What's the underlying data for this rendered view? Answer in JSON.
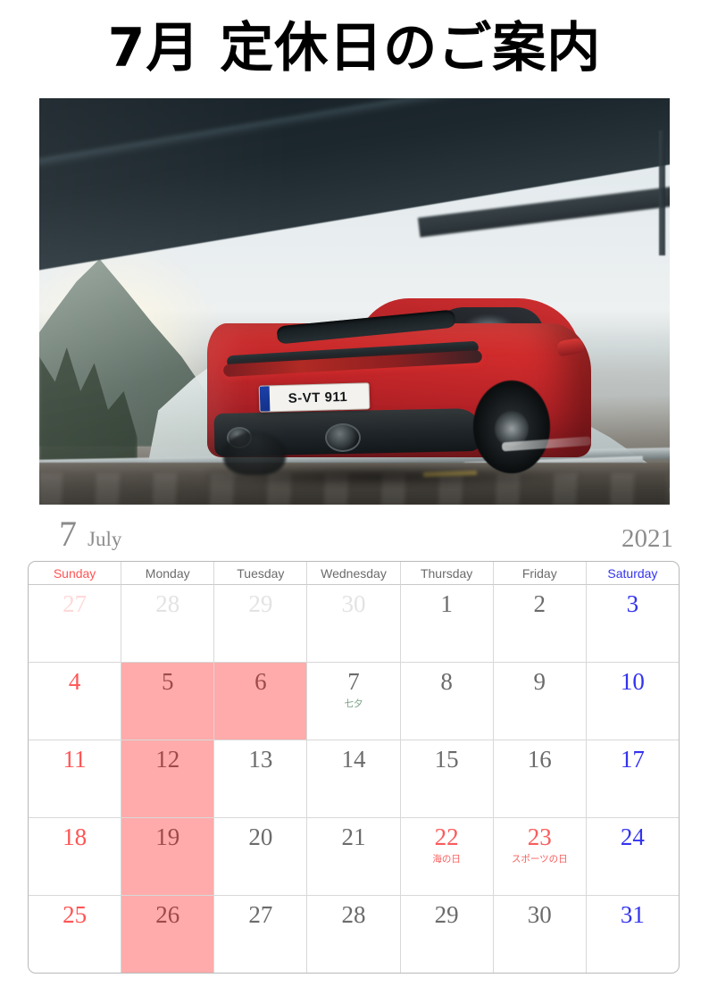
{
  "page": {
    "title": "7月 定休日のご案内"
  },
  "photo": {
    "alt_name": "red-porsche-911-mountain-road-photo",
    "license_plate": "S-VT 911"
  },
  "month_header": {
    "month_number": "7",
    "month_name": "July",
    "year": "2021"
  },
  "colors": {
    "sunday": "#ff5555",
    "saturday": "#3333ee",
    "weekday": "#6b6b6b",
    "outside_month": "#e0e0e0",
    "outside_month_sunday": "#ffd9d9",
    "holiday": "#fa5c5c",
    "event_note": "#79a186",
    "closed_highlight": "#ffabab"
  },
  "weekday_headers": [
    {
      "label": "Sunday",
      "color": "#ff5555"
    },
    {
      "label": "Monday",
      "color": "#6b6b6b"
    },
    {
      "label": "Tuesday",
      "color": "#6b6b6b"
    },
    {
      "label": "Wednesday",
      "color": "#6b6b6b"
    },
    {
      "label": "Thursday",
      "color": "#6b6b6b"
    },
    {
      "label": "Friday",
      "color": "#6b6b6b"
    },
    {
      "label": "Saturday",
      "color": "#3333ee"
    }
  ],
  "weeks": [
    [
      {
        "day": "27",
        "color": "#ffd9d9",
        "note": "",
        "note_color": "",
        "closed": false,
        "outside": true
      },
      {
        "day": "28",
        "color": "#e3e3e3",
        "note": "",
        "note_color": "",
        "closed": false,
        "outside": true
      },
      {
        "day": "29",
        "color": "#e3e3e3",
        "note": "",
        "note_color": "",
        "closed": false,
        "outside": true
      },
      {
        "day": "30",
        "color": "#e3e3e3",
        "note": "",
        "note_color": "",
        "closed": false,
        "outside": true
      },
      {
        "day": "1",
        "color": "#6b6b6b",
        "note": "",
        "note_color": "",
        "closed": false,
        "outside": false
      },
      {
        "day": "2",
        "color": "#6b6b6b",
        "note": "",
        "note_color": "",
        "closed": false,
        "outside": false
      },
      {
        "day": "3",
        "color": "#3333ee",
        "note": "",
        "note_color": "",
        "closed": false,
        "outside": false
      }
    ],
    [
      {
        "day": "4",
        "color": "#ff5555",
        "note": "",
        "note_color": "",
        "closed": false,
        "outside": false
      },
      {
        "day": "5",
        "color": "#9e4a4a",
        "note": "",
        "note_color": "",
        "closed": true,
        "outside": false
      },
      {
        "day": "6",
        "color": "#9e4a4a",
        "note": "",
        "note_color": "",
        "closed": true,
        "outside": false
      },
      {
        "day": "7",
        "color": "#6b6b6b",
        "note": "七夕",
        "note_color": "#79a186",
        "closed": false,
        "outside": false
      },
      {
        "day": "8",
        "color": "#6b6b6b",
        "note": "",
        "note_color": "",
        "closed": false,
        "outside": false
      },
      {
        "day": "9",
        "color": "#6b6b6b",
        "note": "",
        "note_color": "",
        "closed": false,
        "outside": false
      },
      {
        "day": "10",
        "color": "#3333ee",
        "note": "",
        "note_color": "",
        "closed": false,
        "outside": false
      }
    ],
    [
      {
        "day": "11",
        "color": "#ff5555",
        "note": "",
        "note_color": "",
        "closed": false,
        "outside": false
      },
      {
        "day": "12",
        "color": "#9e4a4a",
        "note": "",
        "note_color": "",
        "closed": true,
        "outside": false
      },
      {
        "day": "13",
        "color": "#6b6b6b",
        "note": "",
        "note_color": "",
        "closed": false,
        "outside": false
      },
      {
        "day": "14",
        "color": "#6b6b6b",
        "note": "",
        "note_color": "",
        "closed": false,
        "outside": false
      },
      {
        "day": "15",
        "color": "#6b6b6b",
        "note": "",
        "note_color": "",
        "closed": false,
        "outside": false
      },
      {
        "day": "16",
        "color": "#6b6b6b",
        "note": "",
        "note_color": "",
        "closed": false,
        "outside": false
      },
      {
        "day": "17",
        "color": "#3333ee",
        "note": "",
        "note_color": "",
        "closed": false,
        "outside": false
      }
    ],
    [
      {
        "day": "18",
        "color": "#ff5555",
        "note": "",
        "note_color": "",
        "closed": false,
        "outside": false
      },
      {
        "day": "19",
        "color": "#9e4a4a",
        "note": "",
        "note_color": "",
        "closed": true,
        "outside": false
      },
      {
        "day": "20",
        "color": "#6b6b6b",
        "note": "",
        "note_color": "",
        "closed": false,
        "outside": false
      },
      {
        "day": "21",
        "color": "#6b6b6b",
        "note": "",
        "note_color": "",
        "closed": false,
        "outside": false
      },
      {
        "day": "22",
        "color": "#fa5c5c",
        "note": "海の日",
        "note_color": "#fa5c5c",
        "closed": false,
        "outside": false
      },
      {
        "day": "23",
        "color": "#fa5c5c",
        "note": "スポーツの日",
        "note_color": "#fa5c5c",
        "closed": false,
        "outside": false
      },
      {
        "day": "24",
        "color": "#3333ee",
        "note": "",
        "note_color": "",
        "closed": false,
        "outside": false
      }
    ],
    [
      {
        "day": "25",
        "color": "#ff5555",
        "note": "",
        "note_color": "",
        "closed": false,
        "outside": false
      },
      {
        "day": "26",
        "color": "#9e4a4a",
        "note": "",
        "note_color": "",
        "closed": true,
        "outside": false
      },
      {
        "day": "27",
        "color": "#6b6b6b",
        "note": "",
        "note_color": "",
        "closed": false,
        "outside": false
      },
      {
        "day": "28",
        "color": "#6b6b6b",
        "note": "",
        "note_color": "",
        "closed": false,
        "outside": false
      },
      {
        "day": "29",
        "color": "#6b6b6b",
        "note": "",
        "note_color": "",
        "closed": false,
        "outside": false
      },
      {
        "day": "30",
        "color": "#6b6b6b",
        "note": "",
        "note_color": "",
        "closed": false,
        "outside": false
      },
      {
        "day": "31",
        "color": "#3333ee",
        "note": "",
        "note_color": "",
        "closed": false,
        "outside": false
      }
    ]
  ]
}
